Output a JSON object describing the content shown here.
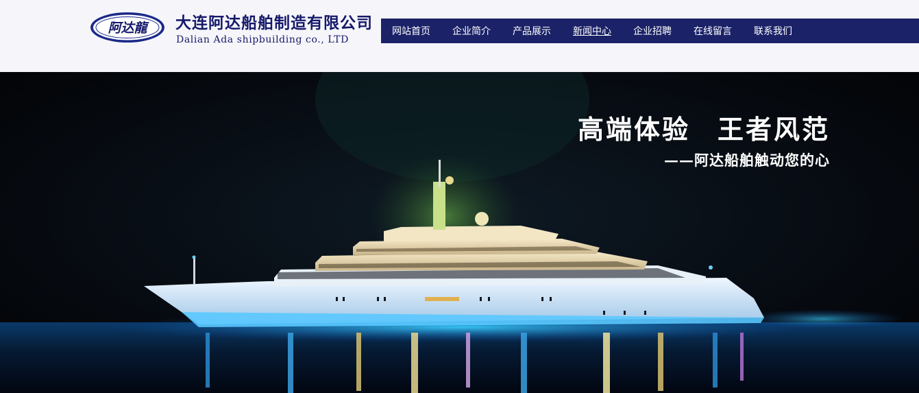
{
  "brand": {
    "logo_text": "阿达龍",
    "company_name_cn": "大连阿达船舶制造有限公司",
    "company_name_en": "Dalian Ada shipbuilding co., LTD"
  },
  "nav": {
    "items": [
      {
        "label": "网站首页"
      },
      {
        "label": "企业简介"
      },
      {
        "label": "产品展示"
      },
      {
        "label": "新闻中心"
      },
      {
        "label": "企业招聘"
      },
      {
        "label": "在线留言"
      },
      {
        "label": "联系我们"
      }
    ]
  },
  "banner": {
    "slogan_left": "高端体验",
    "slogan_right": "王者风范",
    "subslogan": "——阿达船舶触动您的心",
    "image_subject": "illuminated-luxury-yacht-at-night"
  },
  "colors": {
    "brand_navy": "#15196a",
    "nav_bg": "#1b2268",
    "header_bg": "#f6f6fa"
  }
}
